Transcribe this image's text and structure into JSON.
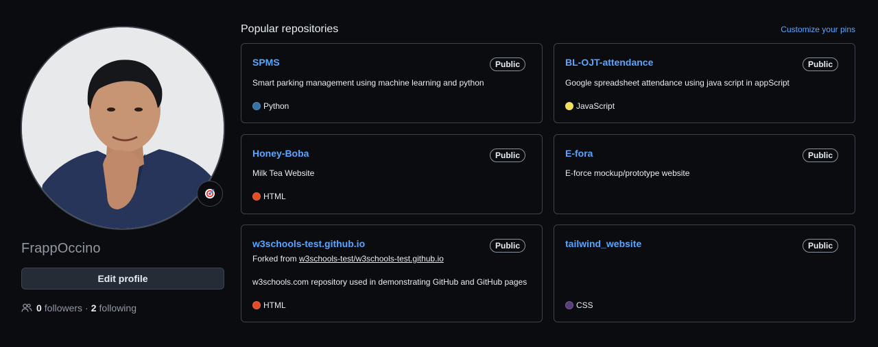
{
  "profile": {
    "username": "FrappOccino",
    "edit_button": "Edit profile",
    "followers_count": "0",
    "followers_label": "followers",
    "separator": "·",
    "following_count": "2",
    "following_label": "following"
  },
  "repos_section": {
    "title": "Popular repositories",
    "customize_link": "Customize your pins"
  },
  "repos": [
    {
      "name": "SPMS",
      "visibility": "Public",
      "description": "Smart parking management using machine learning and python",
      "language": "Python",
      "language_color": "#3572A5"
    },
    {
      "name": "BL-OJT-attendance",
      "visibility": "Public",
      "description": "Google spreadsheet attendance using java script in appScript",
      "language": "JavaScript",
      "language_color": "#f1e05a"
    },
    {
      "name": "Honey-Boba",
      "visibility": "Public",
      "description": "Milk Tea Website",
      "language": "HTML",
      "language_color": "#e34c26"
    },
    {
      "name": "E-fora",
      "visibility": "Public",
      "description": "E-force mockup/prototype website",
      "language": "",
      "language_color": ""
    },
    {
      "name": "w3schools-test.github.io",
      "visibility": "Public",
      "forked_prefix": "Forked from ",
      "forked_from": "w3schools-test/w3schools-test.github.io",
      "description": "w3schools.com repository used in demonstrating GitHub and GitHub pages",
      "language": "HTML",
      "language_color": "#e34c26"
    },
    {
      "name": "tailwind_website",
      "visibility": "Public",
      "description": "",
      "language": "CSS",
      "language_color": "#563d7c"
    }
  ],
  "icons": {
    "status": "target-emoji-icon",
    "people": "people-icon"
  }
}
